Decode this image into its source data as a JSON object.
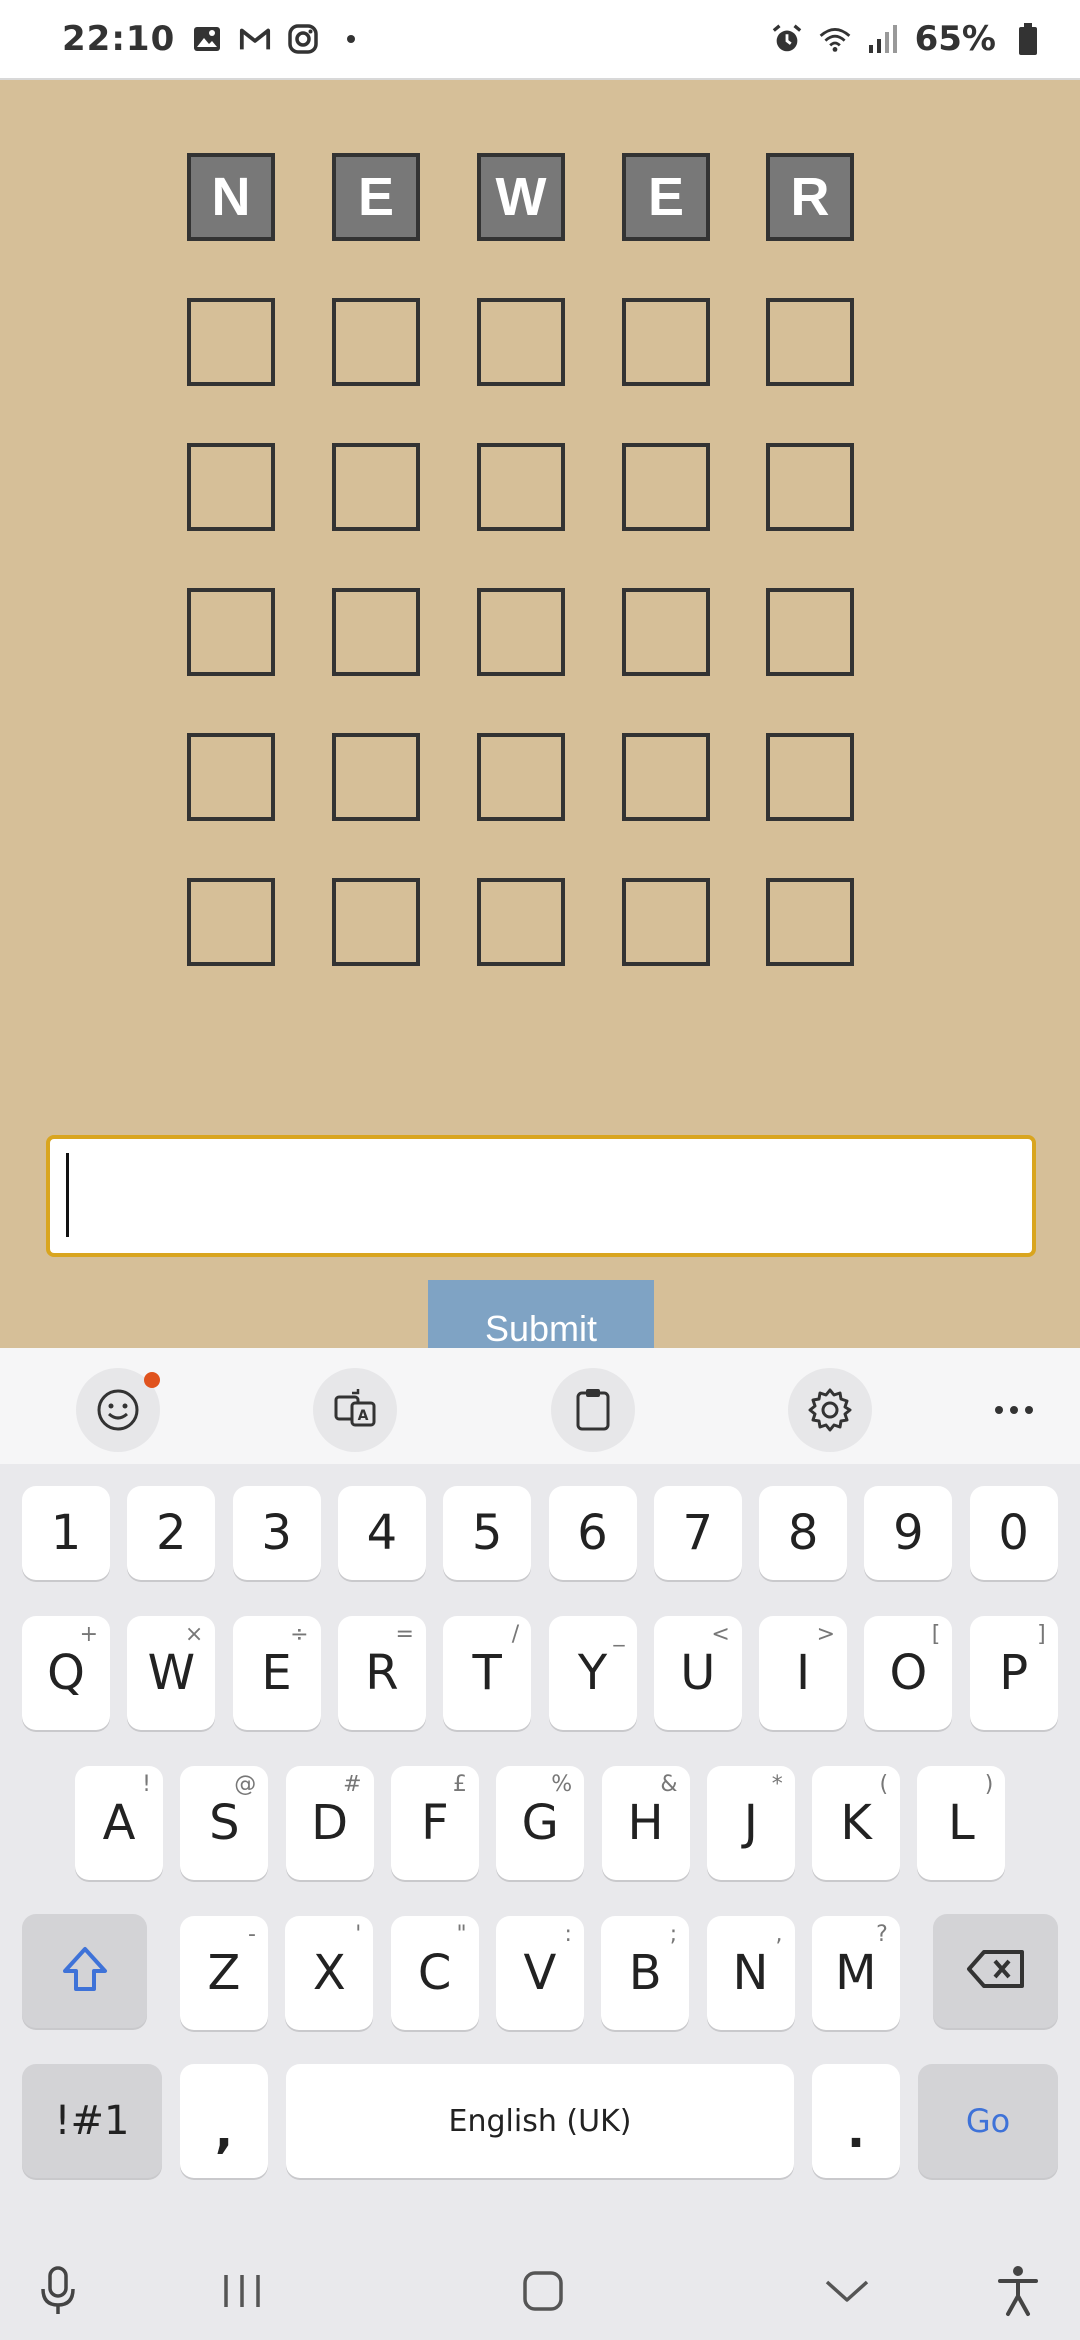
{
  "status_bar": {
    "time": "22:10",
    "notification_icons": [
      "gallery-icon",
      "gmail-icon",
      "instagram-icon"
    ],
    "system_icons": [
      "alarm-icon",
      "wifi-icon",
      "signal-icon",
      "battery-icon"
    ],
    "battery": "65%"
  },
  "board": {
    "rows": [
      [
        "N",
        "E",
        "W",
        "E",
        "R"
      ],
      [
        "",
        "",
        "",
        "",
        ""
      ],
      [
        "",
        "",
        "",
        "",
        ""
      ],
      [
        "",
        "",
        "",
        "",
        ""
      ],
      [
        "",
        "",
        "",
        "",
        ""
      ],
      [
        "",
        "",
        "",
        "",
        ""
      ]
    ],
    "filled_color": "#787878",
    "background": "#d6bf98"
  },
  "input": {
    "value": "",
    "border_color": "#d9a51f"
  },
  "submit": {
    "label": "Submit",
    "color": "#7fa3c4"
  },
  "keyboard": {
    "toolbar": [
      "emoji-icon",
      "translate-icon",
      "clipboard-icon",
      "settings-icon",
      "more-icon"
    ],
    "numbers": [
      "1",
      "2",
      "3",
      "4",
      "5",
      "6",
      "7",
      "8",
      "9",
      "0"
    ],
    "row1": [
      {
        "key": "Q",
        "hint": "+"
      },
      {
        "key": "W",
        "hint": "×"
      },
      {
        "key": "E",
        "hint": "÷"
      },
      {
        "key": "R",
        "hint": "="
      },
      {
        "key": "T",
        "hint": "/"
      },
      {
        "key": "Y",
        "hint": "_"
      },
      {
        "key": "U",
        "hint": "<"
      },
      {
        "key": "I",
        "hint": ">"
      },
      {
        "key": "O",
        "hint": "["
      },
      {
        "key": "P",
        "hint": "]"
      }
    ],
    "row2": [
      {
        "key": "A",
        "hint": "!"
      },
      {
        "key": "S",
        "hint": "@"
      },
      {
        "key": "D",
        "hint": "#"
      },
      {
        "key": "F",
        "hint": "£"
      },
      {
        "key": "G",
        "hint": "%"
      },
      {
        "key": "H",
        "hint": "&"
      },
      {
        "key": "J",
        "hint": "*"
      },
      {
        "key": "K",
        "hint": "("
      },
      {
        "key": "L",
        "hint": ")"
      }
    ],
    "row3": [
      {
        "key": "Z",
        "hint": "-"
      },
      {
        "key": "X",
        "hint": "'"
      },
      {
        "key": "C",
        "hint": "\""
      },
      {
        "key": "V",
        "hint": ":"
      },
      {
        "key": "B",
        "hint": ";"
      },
      {
        "key": "N",
        "hint": ","
      },
      {
        "key": "M",
        "hint": "?"
      }
    ],
    "symbols_label": "!#1",
    "comma": ",",
    "space_label": "English (UK)",
    "period": ".",
    "go_label": "Go",
    "shift_icon": "shift-icon",
    "backspace_icon": "backspace-icon"
  },
  "nav_bar": [
    "mic-icon",
    "recents-icon",
    "home-icon",
    "hide-keyboard-icon",
    "accessibility-icon"
  ]
}
